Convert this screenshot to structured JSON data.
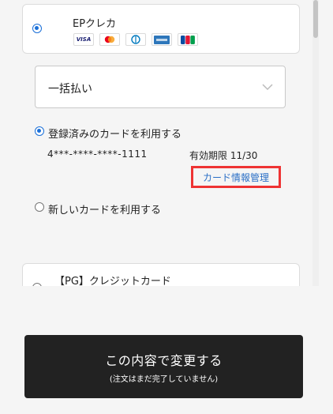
{
  "payment_method": {
    "name": "EPクレカ",
    "brands": [
      "VISA",
      "Mastercard",
      "Diners",
      "AMEX",
      "JCB"
    ]
  },
  "installment_select": {
    "value": "一括払い"
  },
  "registered_option": {
    "label": "登録済みのカードを利用する",
    "card_number": "4***-****-****-1111",
    "expiry": "有効期限 11/30",
    "manage_link": "カード情報管理"
  },
  "new_card_option": {
    "label": "新しいカードを利用する"
  },
  "pg_method": {
    "name": "【PG】クレジットカード"
  },
  "submit": {
    "label": "この内容で変更する",
    "note": "(注文はまだ完了していません)"
  },
  "colors": {
    "accent": "#1a6fd8",
    "link": "#2b6fc6",
    "highlight": "#e33333",
    "button": "#222222"
  }
}
